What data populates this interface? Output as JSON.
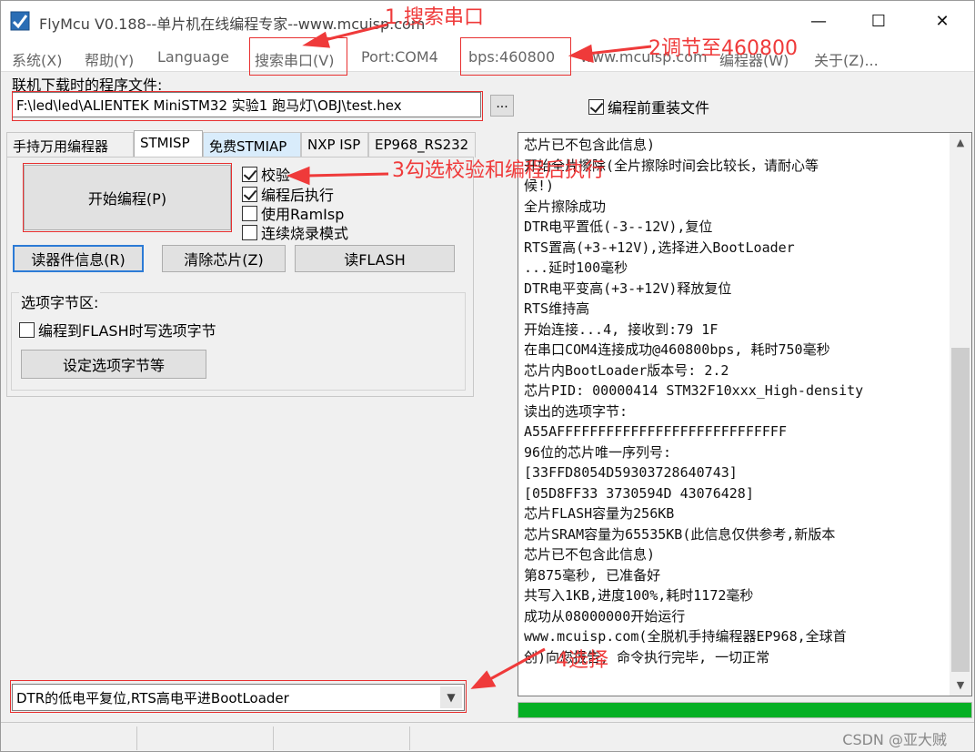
{
  "window": {
    "title": "FlyMcu V0.188--单片机在线编程专家--www.mcuisp.com",
    "min_glyph": "—",
    "max_glyph": "☐",
    "close_glyph": "✕"
  },
  "menu": {
    "system": "系统(X)",
    "help": "帮助(Y)",
    "language": "Language",
    "search_port": "搜索串口(V)",
    "port": "Port:COM4",
    "bps": "bps:460800",
    "website": "www.mcuisp.com",
    "programmer": "编程器(W)",
    "about": "关于(Z)..."
  },
  "file": {
    "label": "联机下载时的程序文件:",
    "path": "F:\\led\\led\\ALIENTEK MiniSTM32 实验1 跑马灯\\OBJ\\test.hex",
    "browse_label": "...",
    "reload_label": "编程前重装文件",
    "reload_checked": true
  },
  "tabs": [
    "手持万用编程器",
    "STMISP",
    "免费STMIAP",
    "NXP ISP",
    "EP968_RS232"
  ],
  "stmisp": {
    "start_button": "开始编程(P)",
    "checkboxes": [
      {
        "label": "校验",
        "checked": true
      },
      {
        "label": "编程后执行",
        "checked": true
      },
      {
        "label": "使用RamIsp",
        "checked": false
      },
      {
        "label": "连续烧录模式",
        "checked": false
      }
    ],
    "read_info_button": "读器件信息(R)",
    "erase_button": "清除芯片(Z)",
    "read_flash_button": "读FLASH",
    "option_group_title": "选项字节区:",
    "option_write_label": "编程到FLASH时写选项字节",
    "option_set_button": "设定选项字节等"
  },
  "log": {
    "lines": [
      "芯片已不包含此信息)",
      "开始全片擦除(全片擦除时间会比较长，请耐心等",
      "候!)",
      "全片擦除成功",
      "DTR电平置低(-3--12V),复位",
      "RTS置高(+3-+12V),选择进入BootLoader",
      "...延时100毫秒",
      "DTR电平变高(+3-+12V)释放复位",
      "RTS维持高",
      "开始连接...4, 接收到:79 1F",
      "在串口COM4连接成功@460800bps, 耗时750毫秒",
      "芯片内BootLoader版本号: 2.2",
      "芯片PID: 00000414  STM32F10xxx_High-density",
      "读出的选项字节:",
      "A55AFFFFFFFFFFFFFFFFFFFFFFFFFFFF",
      "96位的芯片唯一序列号:",
      "[33FFD8054D59303728640743]",
      "[05D8FF33 3730594D 43076428]",
      "芯片FLASH容量为256KB",
      "芯片SRAM容量为65535KB(此信息仅供参考,新版本",
      "芯片已不包含此信息)",
      "第875毫秒, 已准备好",
      "共写入1KB,进度100%,耗时1172毫秒",
      "成功从08000000开始运行",
      "www.mcuisp.com(全脱机手持编程器EP968,全球首",
      "创)向您报告, 命令执行完毕, 一切正常"
    ],
    "scroll_up": "▲",
    "scroll_down": "▼"
  },
  "progress": {
    "value": 1.0,
    "color": "#06b025"
  },
  "reset_mode": {
    "selected": "DTR的低电平复位,RTS高电平进BootLoader",
    "arrow": "▼"
  },
  "watermark": "CSDN @亚大贼",
  "annotations": {
    "color": "#ef3a3a",
    "step1": "1.搜索串口",
    "step2": "2调节至460800",
    "step3": "3勾选校验和编程后执行",
    "step4": "4选择"
  }
}
